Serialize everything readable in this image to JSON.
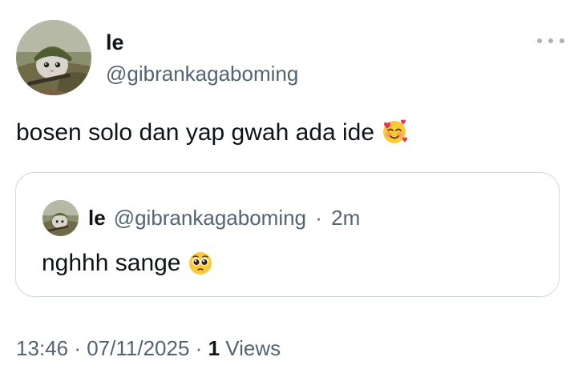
{
  "author": {
    "display_name": "le",
    "handle": "@gibrankagaboming",
    "avatar_icon": "cat-soldier-avatar-icon"
  },
  "tweet": {
    "text": "bosen solo dan yap gwah ada ide",
    "emoji_icon": "smiling-face-with-hearts-icon"
  },
  "quoted_tweet": {
    "display_name": "le",
    "handle": "@gibrankagaboming",
    "separator": "·",
    "age": "2m",
    "text": "nghhh sange",
    "emoji_icon": "pleading-face-icon"
  },
  "footer": {
    "time": "13:46",
    "separator_1": "·",
    "date": "07/11/2025",
    "separator_2": "·",
    "views_count": "1",
    "views_label": "Views"
  },
  "more_icon": "more-options-icon",
  "colors": {
    "text_primary": "#0f1419",
    "text_secondary": "#536471",
    "border": "#cfd9de"
  }
}
